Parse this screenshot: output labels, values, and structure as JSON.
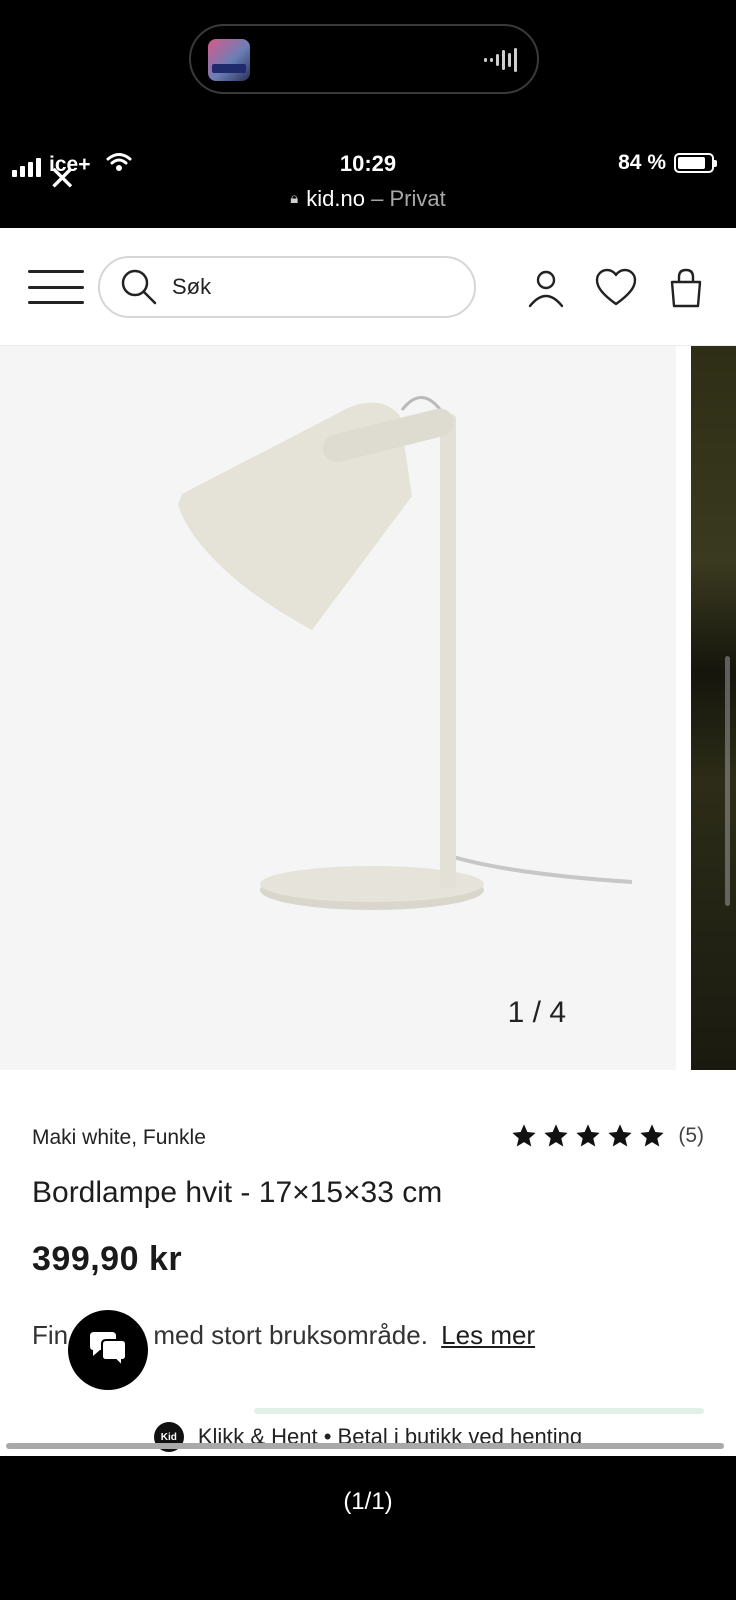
{
  "status_bar": {
    "carrier": "ice+",
    "time": "10:29",
    "battery": "84 %",
    "battery_level": 0.84
  },
  "browser": {
    "host": "kid.no",
    "mode": "– Privat"
  },
  "header": {
    "search_placeholder": "Søk"
  },
  "gallery": {
    "counter": "1 / 4"
  },
  "product": {
    "brand": "Maki white, Funkle",
    "rating_stars": 5,
    "rating_count": "(5)",
    "title": "Bordlampe hvit - 17×15×33 cm",
    "price": "399,90 kr",
    "description": "Fin lampe med stort bruksområde.",
    "read_more": "Les mer"
  },
  "promo": {
    "badge": "Kid",
    "text": "Klikk & Hent • Betal i butikk ved henting"
  },
  "viewer": {
    "pager": "(1/1)"
  },
  "colors": {
    "background_dark": "#000000",
    "page": "#ffffff",
    "image_bg": "#f5f5f5",
    "lamp": "#e4e1d7"
  }
}
